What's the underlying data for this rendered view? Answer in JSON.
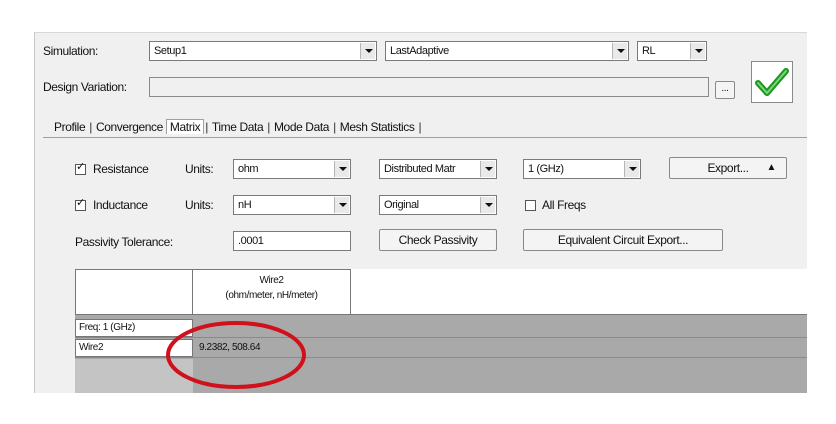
{
  "simulation": {
    "label": "Simulation:",
    "setup": "Setup1",
    "solution": "LastAdaptive",
    "type": "RL"
  },
  "design_variation": {
    "label": "Design Variation:",
    "browse_label": "..."
  },
  "tabs": [
    {
      "label": "Profile"
    },
    {
      "label": "Convergence"
    },
    {
      "label": "Matrix",
      "selected": true
    },
    {
      "label": "Time Data"
    },
    {
      "label": "Mode Data"
    },
    {
      "label": "Mesh Statistics"
    }
  ],
  "resistance": {
    "checkbox_label": "Resistance",
    "checked": true,
    "units_label": "Units:",
    "units": "ohm",
    "matrix_type": "Distributed Matr",
    "freq": "1 (GHz)",
    "export_label": "Export..."
  },
  "inductance": {
    "checkbox_label": "Inductance",
    "checked": true,
    "units_label": "Units:",
    "units": "nH",
    "matrix_type": "Original",
    "all_freqs_label": "All Freqs",
    "all_freqs_checked": false
  },
  "passivity": {
    "label": "Passivity Tolerance:",
    "value": ".0001",
    "check_label": "Check Passivity",
    "equivalent_label": "Equivalent Circuit Export..."
  },
  "matrix_table": {
    "column_header": "Wire2",
    "column_units": "(ohm/meter, nH/meter)",
    "freq_row_label": "Freq: 1 (GHz)",
    "row_label": "Wire2",
    "cell_value": "9.2382, 508.64"
  },
  "colors": {
    "annotation_circle": "#d0101a",
    "ok_check": "#1a9a1a",
    "grid_background": "#a9a9a9"
  }
}
